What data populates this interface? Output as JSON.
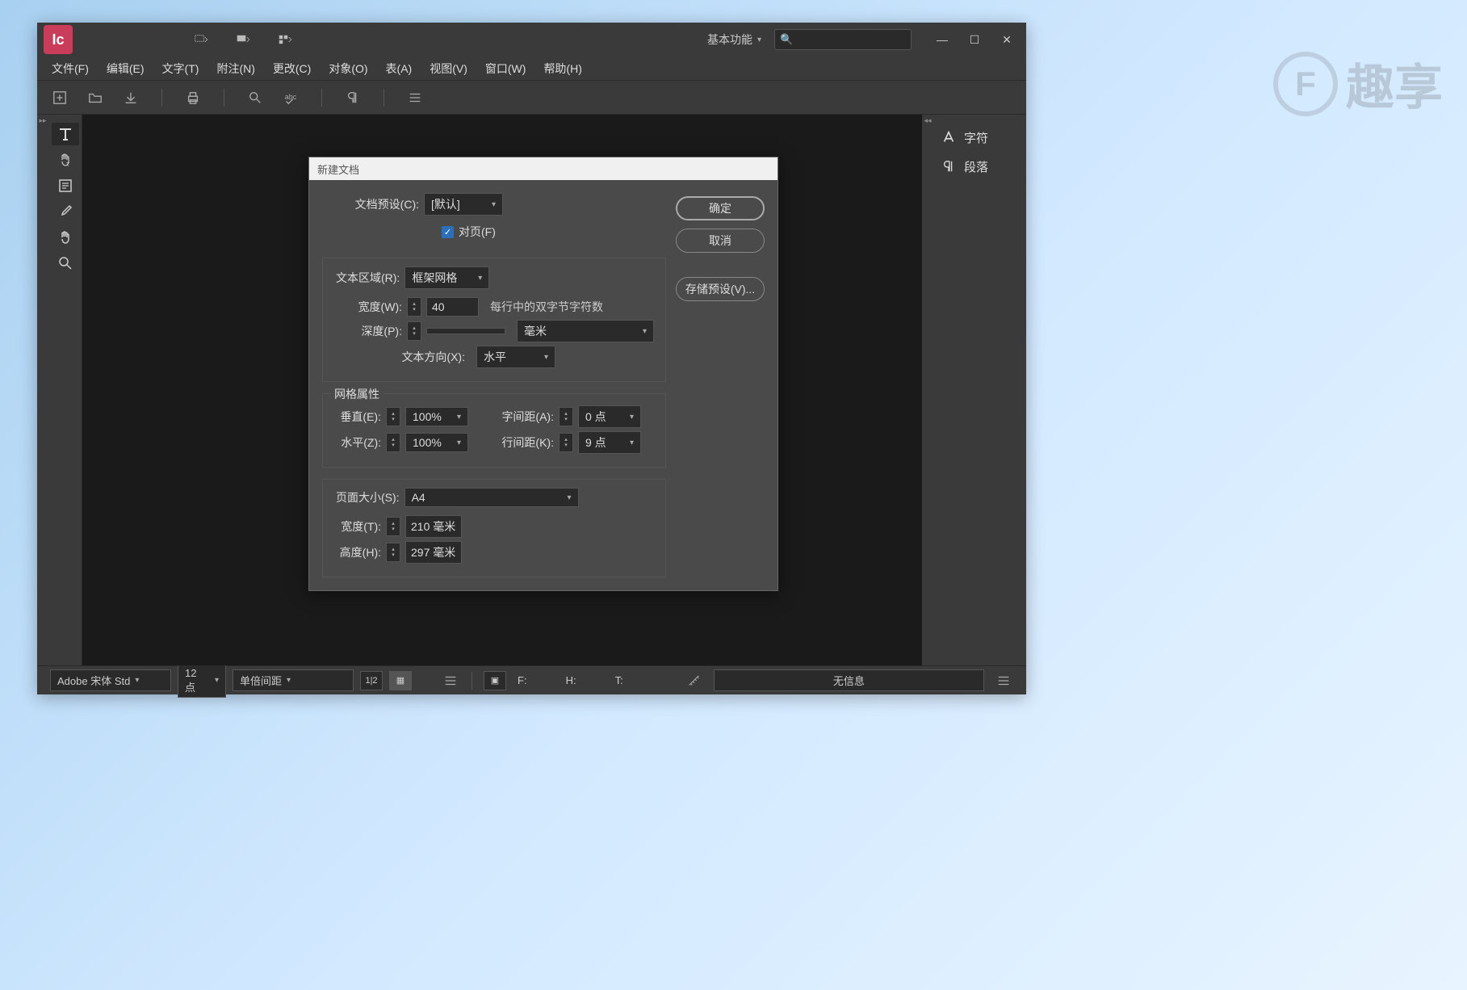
{
  "app": {
    "icon_letter": "Ic"
  },
  "titlebar": {
    "workspace": "基本功能",
    "search_placeholder": ""
  },
  "menu": {
    "file": "文件(F)",
    "edit": "编辑(E)",
    "text": "文字(T)",
    "note": "附注(N)",
    "change": "更改(C)",
    "object": "对象(O)",
    "table": "表(A)",
    "view": "视图(V)",
    "window": "窗口(W)",
    "help": "帮助(H)"
  },
  "right_panel": {
    "char": "字符",
    "para": "段落"
  },
  "dialog": {
    "title": "新建文档",
    "preset_label": "文档预设(C):",
    "preset_value": "[默认]",
    "facing_label": "对页(F)",
    "region_label": "文本区域(R):",
    "region_value": "框架网格",
    "width_label": "宽度(W):",
    "width_value": "40",
    "width_hint": "每行中的双字节字符数",
    "depth_label": "深度(P):",
    "depth_value": "",
    "depth_unit": "毫米",
    "direction_label": "文本方向(X):",
    "direction_value": "水平",
    "grid_section": "网格属性",
    "vertical_label": "垂直(E):",
    "vertical_value": "100%",
    "char_space_label": "字间距(A):",
    "char_space_value": "0 点",
    "horizontal_label": "水平(Z):",
    "horizontal_value": "100%",
    "line_space_label": "行间距(K):",
    "line_space_value": "9 点",
    "page_size_label": "页面大小(S):",
    "page_size_value": "A4",
    "page_width_label": "宽度(T):",
    "page_width_value": "210 毫米",
    "page_height_label": "高度(H):",
    "page_height_value": "297 毫米",
    "ok": "确定",
    "cancel": "取消",
    "save_preset": "存储预设(V)..."
  },
  "status": {
    "font": "Adobe 宋体 Std",
    "size": "12 点",
    "spacing": "单倍间距",
    "f_label": "F:",
    "h_label": "H:",
    "t_label": "T:",
    "info": "无信息"
  },
  "watermark": {
    "letter": "F",
    "text": "趣享"
  }
}
